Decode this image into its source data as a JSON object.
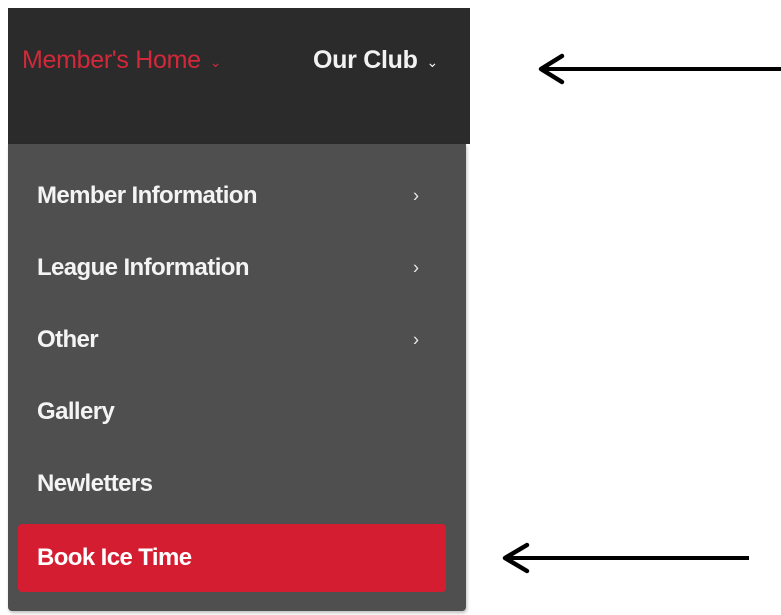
{
  "nav": {
    "items": [
      {
        "label": "Member's Home",
        "caret": "⌄",
        "active": true
      },
      {
        "label": "Our Club",
        "caret": "⌄",
        "active": false
      }
    ]
  },
  "dropdown": {
    "items": [
      {
        "label": "Member Information",
        "has_submenu": true,
        "chevron": "›"
      },
      {
        "label": "League Information",
        "has_submenu": true,
        "chevron": "›"
      },
      {
        "label": "Other",
        "has_submenu": true,
        "chevron": "›"
      },
      {
        "label": "Gallery",
        "has_submenu": false
      },
      {
        "label": "Newletters",
        "has_submenu": false
      },
      {
        "label": "Book Ice Time",
        "has_submenu": false,
        "highlighted": true
      }
    ]
  },
  "annotations": {
    "arrows": [
      {
        "direction": "left",
        "points_to": "nav-bar"
      },
      {
        "direction": "left",
        "points_to": "book-ice-time"
      }
    ]
  },
  "colors": {
    "nav_bg": "#2b2b2b",
    "dropdown_bg": "#4f4f4f",
    "accent": "#d51d32",
    "text_light": "#f4f4f4"
  }
}
